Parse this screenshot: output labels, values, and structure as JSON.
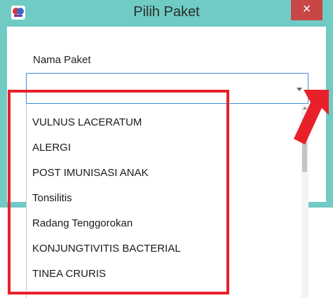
{
  "window": {
    "title": "Pilih Paket",
    "close_label": "×",
    "app_icon": "app-logo-icon"
  },
  "form": {
    "field_label": "Nama Paket",
    "combo_value": ""
  },
  "dropdown": {
    "items": [
      "VULNUS LACERATUM",
      "ALERGI",
      "POST IMUNISASI ANAK",
      "Tonsilitis",
      "Radang Tenggorokan",
      "KONJUNGTIVITIS BACTERIAL",
      "TINEA CRURIS"
    ]
  },
  "colors": {
    "titlebar": "#6fcbc4",
    "close_button": "#c74646",
    "combo_border": "#3c8fd4",
    "annotation": "#e8202a"
  },
  "icons": {
    "combo_arrow": "chevron-down-icon",
    "scroll_up": "chevron-up-icon",
    "callout": "red-arrow-icon"
  }
}
